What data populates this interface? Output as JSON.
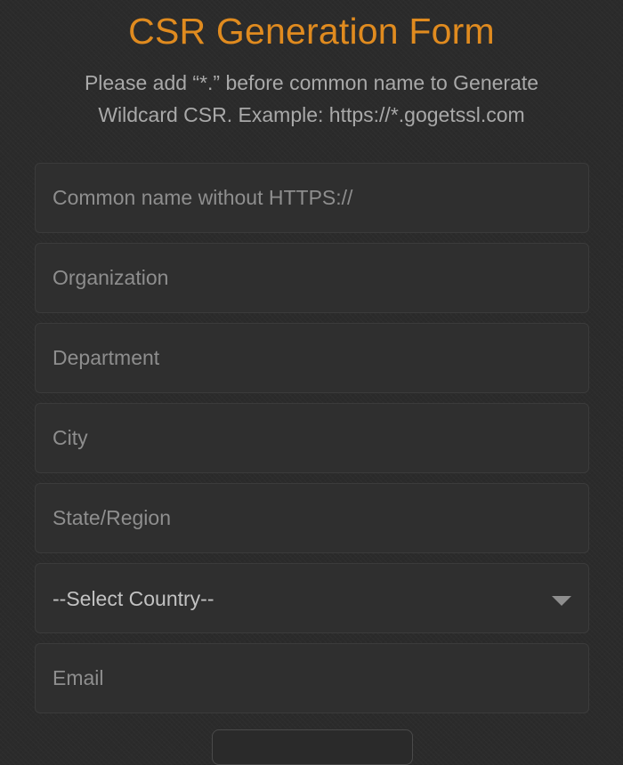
{
  "form": {
    "title": "CSR Generation Form",
    "subtitle_line1": "Please add “*.” before common name to Generate",
    "subtitle_line2": "Wildcard CSR. Example: https://*.gogetssl.com",
    "fields": {
      "common_name": {
        "placeholder": "Common name without HTTPS://",
        "value": ""
      },
      "organization": {
        "placeholder": "Organization",
        "value": ""
      },
      "department": {
        "placeholder": "Department",
        "value": ""
      },
      "city": {
        "placeholder": "City",
        "value": ""
      },
      "state": {
        "placeholder": "State/Region",
        "value": ""
      },
      "country": {
        "selected": "--Select Country--",
        "icon": "chevron-down-icon"
      },
      "email": {
        "placeholder": "Email",
        "value": ""
      }
    }
  },
  "colors": {
    "accent": "#e08b1f",
    "background": "#2b2b2b",
    "field_background": "#2f2f2f",
    "placeholder": "#8e8e8e",
    "subtitle": "#a9a9a9"
  }
}
